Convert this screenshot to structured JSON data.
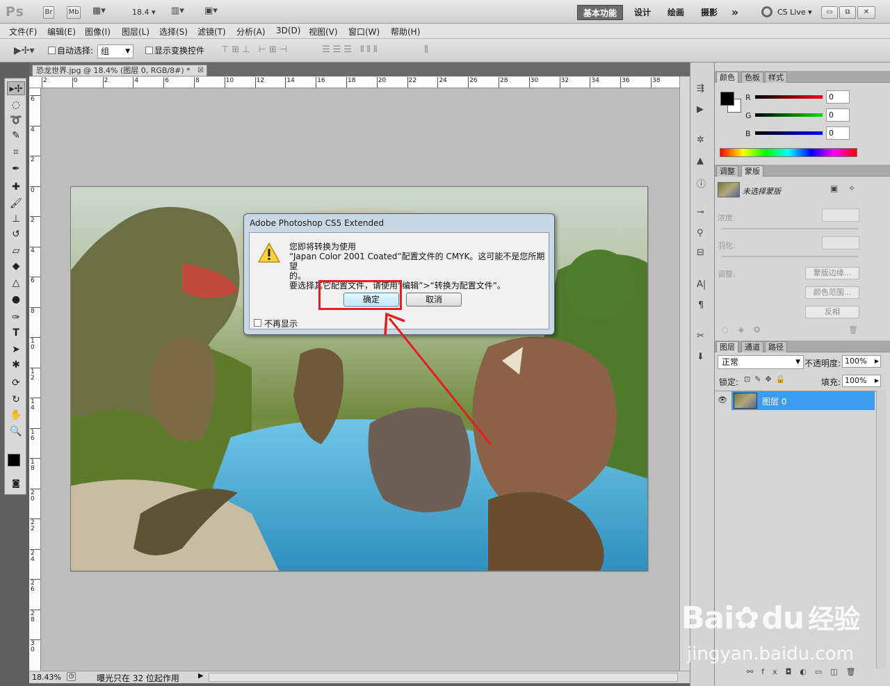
{
  "app": {
    "logo": "Ps",
    "bridge_label": "Br",
    "minibridge_label": "Mb",
    "zoom_value": "18.4",
    "workspaces": [
      "基本功能",
      "设计",
      "绘画",
      "摄影"
    ],
    "more_label": "»",
    "cslive_label": "CS Live"
  },
  "menu": [
    "文件(F)",
    "编辑(E)",
    "图像(I)",
    "图层(L)",
    "选择(S)",
    "滤镜(T)",
    "分析(A)",
    "3D(D)",
    "视图(V)",
    "窗口(W)",
    "帮助(H)"
  ],
  "options": {
    "auto_select_label": "自动选择:",
    "auto_select_value": "组",
    "show_transform_label": "显示变换控件"
  },
  "document": {
    "tab_title": "恐龙世界.jpg @ 18.4% (图层 0, RGB/8#) *",
    "ruler_h": [
      "2",
      "0",
      "2",
      "4",
      "6",
      "8",
      "10",
      "12",
      "14",
      "16",
      "18",
      "20",
      "22",
      "24",
      "26",
      "28",
      "30",
      "32",
      "34",
      "36",
      "38"
    ],
    "ruler_v": [
      "6",
      "4",
      "2",
      "0",
      "2",
      "4",
      "6",
      "8",
      "1 0",
      "1 2",
      "1 4",
      "1 6",
      "1 8",
      "2 0",
      "2 2",
      "2 4",
      "2 6",
      "2 8",
      "3 0"
    ]
  },
  "status": {
    "zoom": "18.43%",
    "info": "曝光只在 32 位起作用"
  },
  "dialog": {
    "title": "Adobe Photoshop CS5 Extended",
    "line1": "您即将转换为使用",
    "line2": "“Japan Color 2001 Coated”配置文件的 CMYK。这可能不是您所期望",
    "line3": "的。",
    "line4": "要选择其它配置文件，请使用“编辑”>“转换为配置文件”。",
    "ok_label": "确定",
    "cancel_label": "取消",
    "dont_show_label": "不再显示"
  },
  "color_panel": {
    "tabs": [
      "颜色",
      "色板",
      "样式"
    ],
    "r_label": "R",
    "g_label": "G",
    "b_label": "B",
    "r_value": "0",
    "g_value": "0",
    "b_value": "0"
  },
  "masks_panel": {
    "tabs": [
      "调整",
      "蒙版"
    ],
    "no_mask_label": "未选择蒙版",
    "density_label": "浓度:",
    "feather_label": "羽化:",
    "refine_label": "调整:",
    "mask_edge_label": "蒙版边缘...",
    "color_range_label": "颜色范围...",
    "invert_label": "反相"
  },
  "layers_panel": {
    "tabs": [
      "图层",
      "通道",
      "路径"
    ],
    "blend_mode": "正常",
    "opacity_label": "不透明度:",
    "opacity_value": "100%",
    "lock_label": "锁定:",
    "fill_label": "填充:",
    "fill_value": "100%",
    "layer_name": "图层 0"
  },
  "watermark": {
    "brand": "Bai",
    "brand2": "du",
    "cn": "经验",
    "url": "jingyan.baidu.com"
  },
  "colors": {
    "highlight": "#e41e1e",
    "layer_selected": "#3c9cf0"
  }
}
